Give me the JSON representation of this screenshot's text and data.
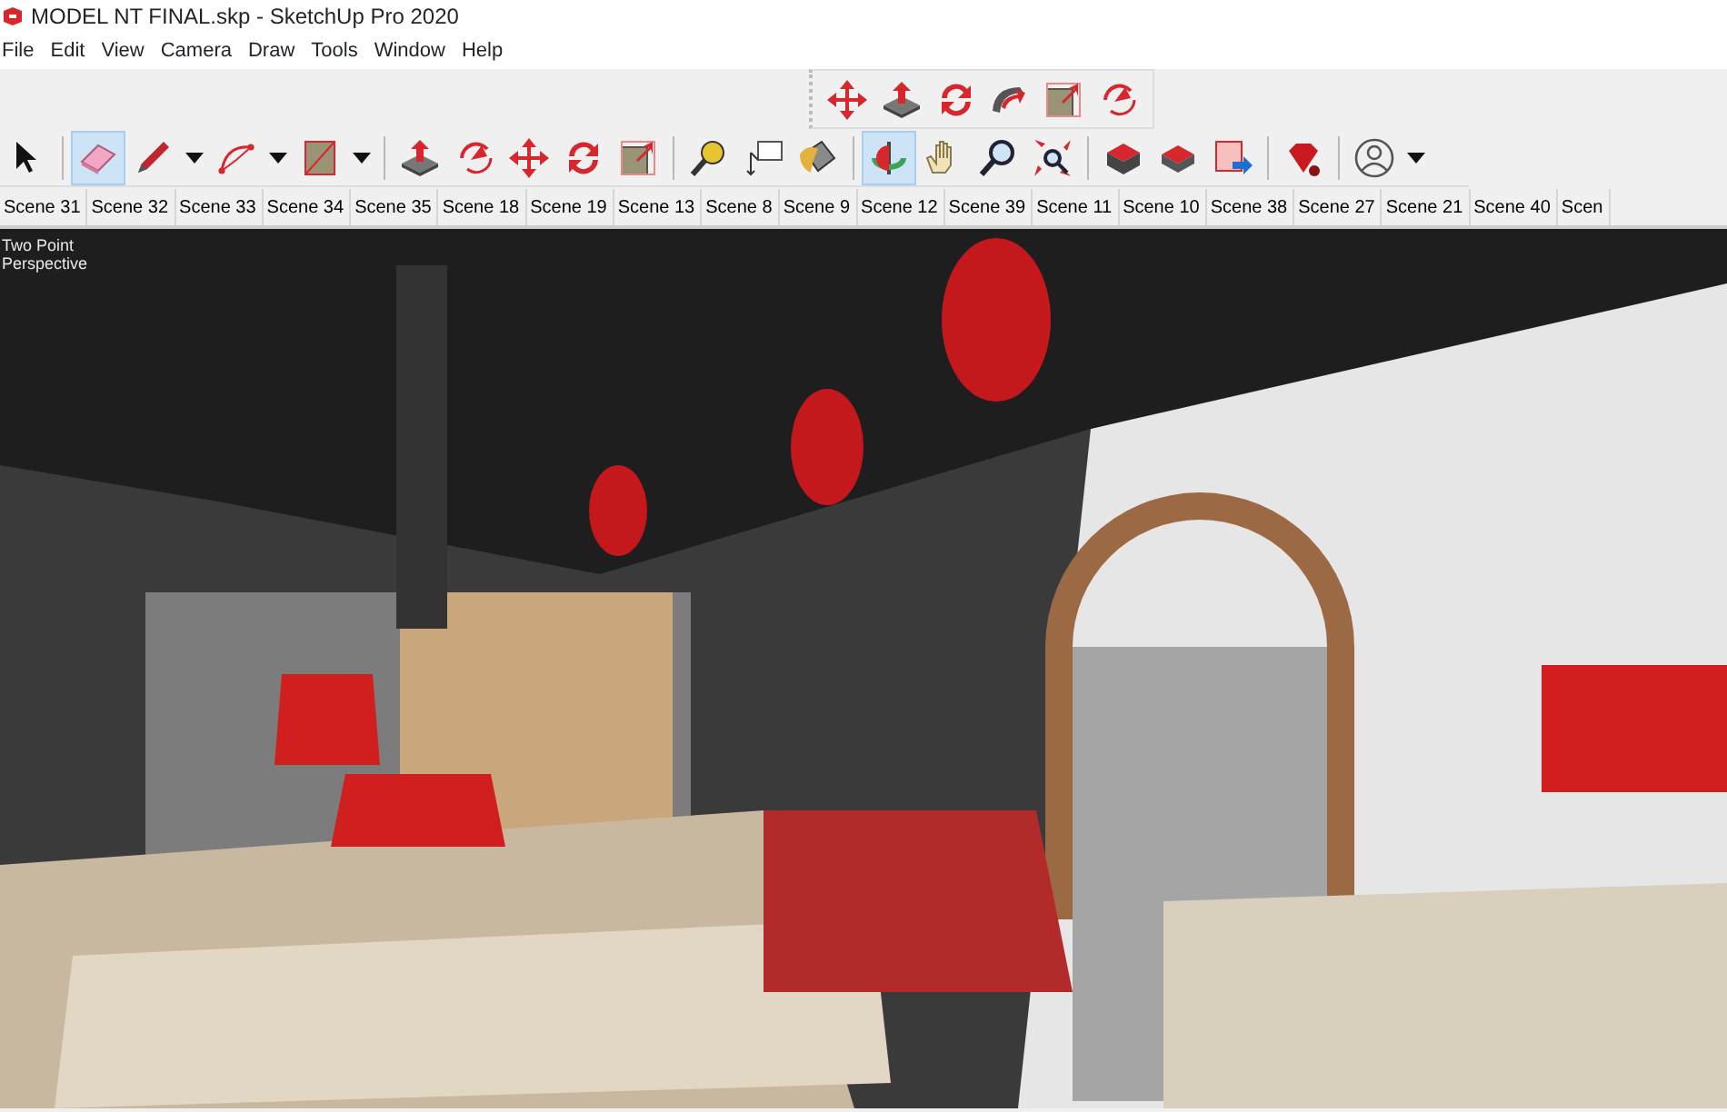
{
  "window": {
    "title": "MODEL NT FINAL.skp - SketchUp Pro 2020"
  },
  "menu": [
    "File",
    "Edit",
    "View",
    "Camera",
    "Draw",
    "Tools",
    "Window",
    "Help"
  ],
  "toolbar_top": [
    {
      "kind": "move",
      "selected": false
    },
    {
      "kind": "pushpull",
      "selected": false
    },
    {
      "kind": "rotate",
      "selected": false
    },
    {
      "kind": "followme",
      "selected": false
    },
    {
      "kind": "scale",
      "selected": false
    },
    {
      "kind": "offset",
      "selected": false
    }
  ],
  "toolbar_main": [
    {
      "kind": "select",
      "selected": false
    },
    {
      "kind": "sep"
    },
    {
      "kind": "eraser",
      "selected": true
    },
    {
      "kind": "pencil",
      "selected": false,
      "has_menu": true
    },
    {
      "kind": "arc",
      "selected": false,
      "has_menu": true
    },
    {
      "kind": "rectangle",
      "selected": false,
      "has_menu": true
    },
    {
      "kind": "sep"
    },
    {
      "kind": "pushpull",
      "selected": false
    },
    {
      "kind": "offset",
      "selected": false
    },
    {
      "kind": "move",
      "selected": false
    },
    {
      "kind": "rotate",
      "selected": false
    },
    {
      "kind": "scale",
      "selected": false
    },
    {
      "kind": "sep"
    },
    {
      "kind": "tape",
      "selected": false
    },
    {
      "kind": "text",
      "selected": false
    },
    {
      "kind": "paint",
      "selected": false
    },
    {
      "kind": "sep"
    },
    {
      "kind": "orbit",
      "selected": true
    },
    {
      "kind": "pan",
      "selected": false
    },
    {
      "kind": "zoom",
      "selected": false
    },
    {
      "kind": "extents",
      "selected": false
    },
    {
      "kind": "sep"
    },
    {
      "kind": "warehouse",
      "selected": false
    },
    {
      "kind": "extension",
      "selected": false
    },
    {
      "kind": "send",
      "selected": false
    },
    {
      "kind": "sep"
    },
    {
      "kind": "ruby",
      "selected": false
    },
    {
      "kind": "sep"
    },
    {
      "kind": "account",
      "selected": false,
      "has_menu": true
    }
  ],
  "scene_tabs": [
    "Scene 31",
    "Scene 32",
    "Scene 33",
    "Scene 34",
    "Scene 35",
    "Scene 18",
    "Scene 19",
    "Scene 13",
    "Scene 8",
    "Scene 9",
    "Scene 12",
    "Scene 39",
    "Scene 11",
    "Scene 10",
    "Scene 38",
    "Scene 27",
    "Scene 21",
    "Scene 40",
    "Scen"
  ],
  "viewport": {
    "kind": "picture",
    "camera_label": "Two Point Perspective"
  }
}
